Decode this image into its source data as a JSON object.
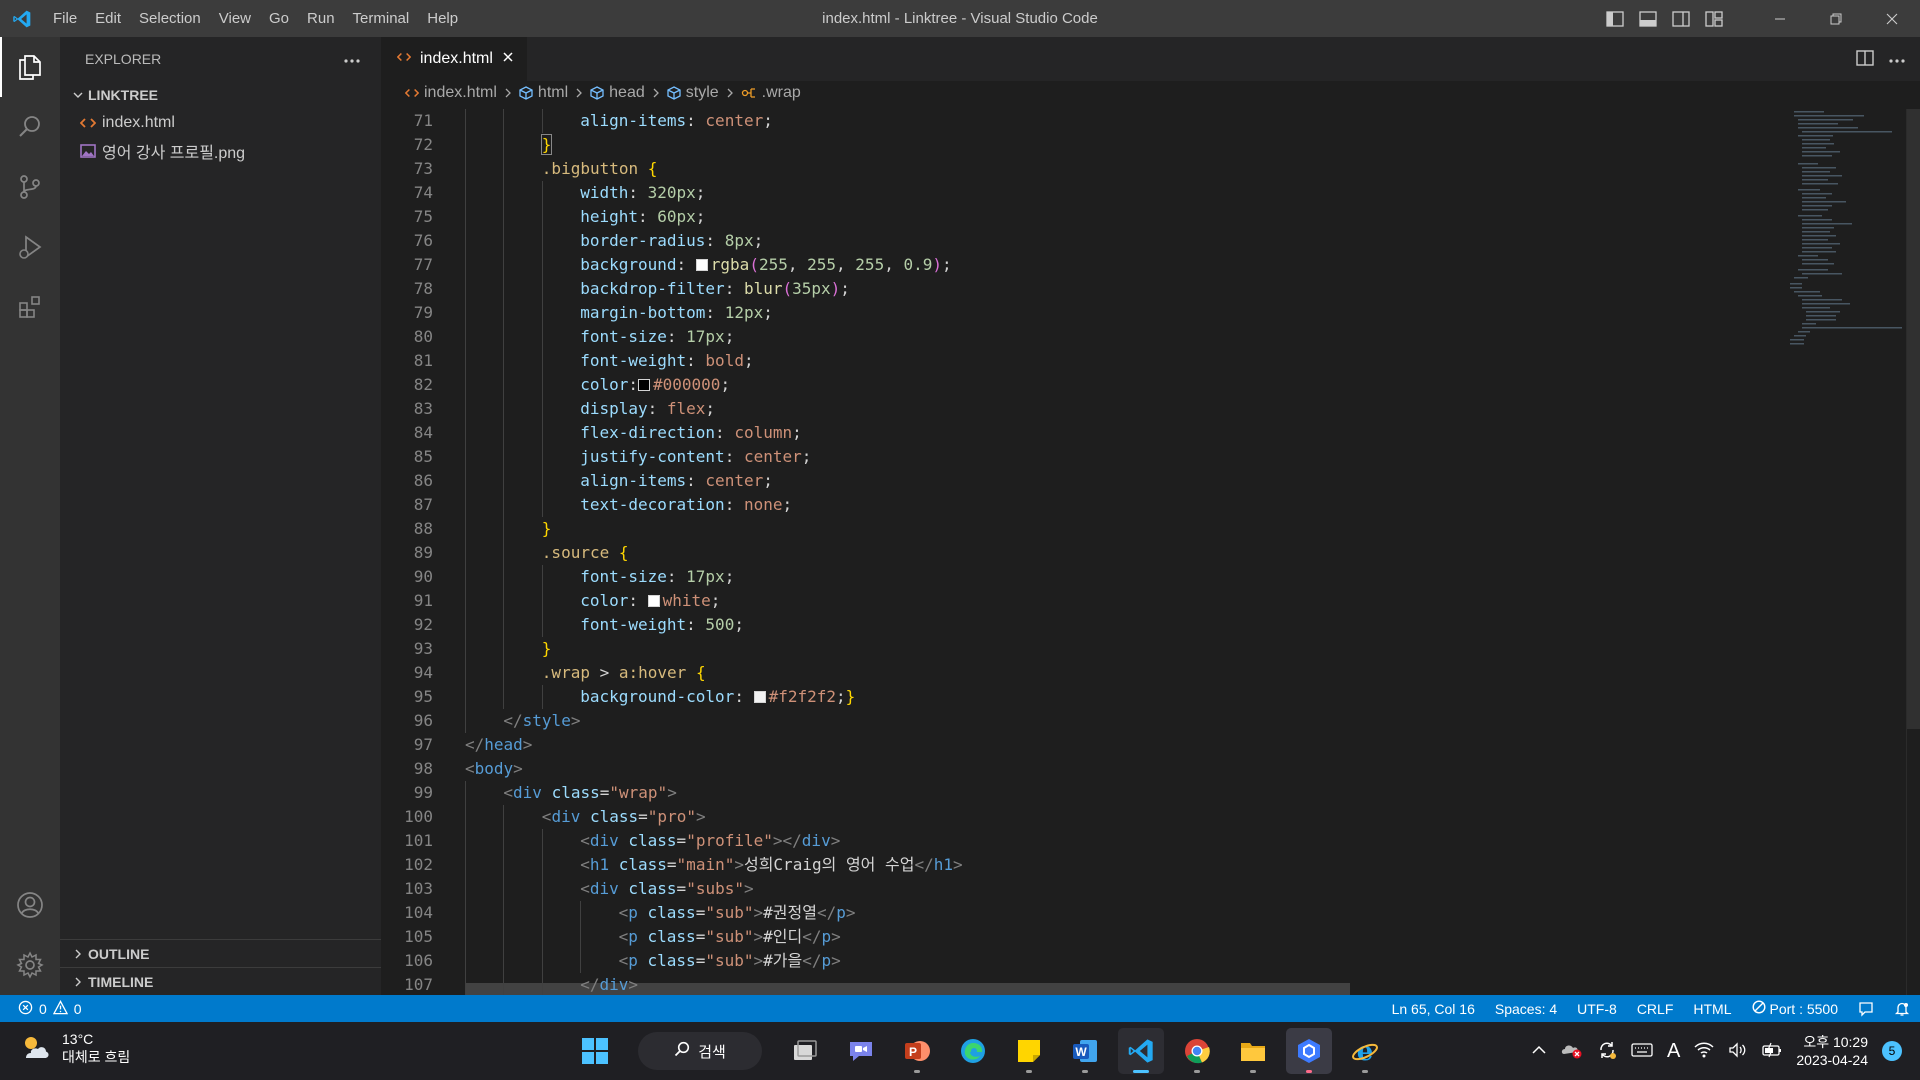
{
  "window": {
    "title": "index.html - Linktree - Visual Studio Code",
    "menu": [
      "File",
      "Edit",
      "Selection",
      "View",
      "Go",
      "Run",
      "Terminal",
      "Help"
    ]
  },
  "sidebar": {
    "title": "EXPLORER",
    "folder": "LINKTREE",
    "files": [
      {
        "name": "index.html",
        "icon": "html-file-icon"
      },
      {
        "name": "영어 강사 프로필.png",
        "icon": "image-file-icon"
      }
    ],
    "outline_label": "OUTLINE",
    "timeline_label": "TIMELINE"
  },
  "editor": {
    "tab_label": "index.html",
    "breadcrumb": [
      "index.html",
      "html",
      "head",
      "style",
      ".wrap"
    ],
    "lines": [
      {
        "n": "71",
        "indent": 3,
        "tokens": [
          [
            "prop",
            "align-items"
          ],
          [
            "def",
            ": "
          ],
          [
            "val",
            "center"
          ],
          [
            "def",
            ";"
          ]
        ]
      },
      {
        "n": "72",
        "indent": 2,
        "tokens": [
          [
            "br",
            "}"
          ]
        ]
      },
      {
        "n": "73",
        "indent": 2,
        "tokens": [
          [
            "sel",
            ".bigbutton"
          ],
          [
            "def",
            " "
          ],
          [
            "br",
            "{"
          ]
        ]
      },
      {
        "n": "74",
        "indent": 3,
        "tokens": [
          [
            "prop",
            "width"
          ],
          [
            "def",
            ": "
          ],
          [
            "num",
            "320px"
          ],
          [
            "def",
            ";"
          ]
        ]
      },
      {
        "n": "75",
        "indent": 3,
        "tokens": [
          [
            "prop",
            "height"
          ],
          [
            "def",
            ": "
          ],
          [
            "num",
            "60px"
          ],
          [
            "def",
            ";"
          ]
        ]
      },
      {
        "n": "76",
        "indent": 3,
        "tokens": [
          [
            "prop",
            "border-radius"
          ],
          [
            "def",
            ": "
          ],
          [
            "num",
            "8px"
          ],
          [
            "def",
            ";"
          ]
        ]
      },
      {
        "n": "77",
        "indent": 3,
        "tokens": [
          [
            "prop",
            "background"
          ],
          [
            "def",
            ": "
          ],
          [
            "swatch",
            "#ffffff"
          ],
          [
            "fn",
            "rgba"
          ],
          [
            "br2",
            "("
          ],
          [
            "num",
            "255"
          ],
          [
            "def",
            ", "
          ],
          [
            "num",
            "255"
          ],
          [
            "def",
            ", "
          ],
          [
            "num",
            "255"
          ],
          [
            "def",
            ", "
          ],
          [
            "num",
            "0.9"
          ],
          [
            "br2",
            ")"
          ],
          [
            "def",
            ";"
          ]
        ]
      },
      {
        "n": "78",
        "indent": 3,
        "tokens": [
          [
            "prop",
            "backdrop-filter"
          ],
          [
            "def",
            ": "
          ],
          [
            "fn",
            "blur"
          ],
          [
            "br2",
            "("
          ],
          [
            "num",
            "35px"
          ],
          [
            "br2",
            ")"
          ],
          [
            "def",
            ";"
          ]
        ]
      },
      {
        "n": "79",
        "indent": 3,
        "tokens": [
          [
            "prop",
            "margin-bottom"
          ],
          [
            "def",
            ": "
          ],
          [
            "num",
            "12px"
          ],
          [
            "def",
            ";"
          ]
        ]
      },
      {
        "n": "80",
        "indent": 3,
        "tokens": [
          [
            "prop",
            "font-size"
          ],
          [
            "def",
            ": "
          ],
          [
            "num",
            "17px"
          ],
          [
            "def",
            ";"
          ]
        ]
      },
      {
        "n": "81",
        "indent": 3,
        "tokens": [
          [
            "prop",
            "font-weight"
          ],
          [
            "def",
            ": "
          ],
          [
            "val",
            "bold"
          ],
          [
            "def",
            ";"
          ]
        ]
      },
      {
        "n": "82",
        "indent": 3,
        "tokens": [
          [
            "prop",
            "color"
          ],
          [
            "def",
            ":"
          ],
          [
            "swatch",
            "#000000"
          ],
          [
            "val",
            "#000000"
          ],
          [
            "def",
            ";"
          ]
        ]
      },
      {
        "n": "83",
        "indent": 3,
        "tokens": [
          [
            "prop",
            "display"
          ],
          [
            "def",
            ": "
          ],
          [
            "val",
            "flex"
          ],
          [
            "def",
            ";"
          ]
        ]
      },
      {
        "n": "84",
        "indent": 3,
        "tokens": [
          [
            "prop",
            "flex-direction"
          ],
          [
            "def",
            ": "
          ],
          [
            "val",
            "column"
          ],
          [
            "def",
            ";"
          ]
        ]
      },
      {
        "n": "85",
        "indent": 3,
        "tokens": [
          [
            "prop",
            "justify-content"
          ],
          [
            "def",
            ": "
          ],
          [
            "val",
            "center"
          ],
          [
            "def",
            ";"
          ]
        ]
      },
      {
        "n": "86",
        "indent": 3,
        "tokens": [
          [
            "prop",
            "align-items"
          ],
          [
            "def",
            ": "
          ],
          [
            "val",
            "center"
          ],
          [
            "def",
            ";"
          ]
        ]
      },
      {
        "n": "87",
        "indent": 3,
        "tokens": [
          [
            "prop",
            "text-decoration"
          ],
          [
            "def",
            ": "
          ],
          [
            "val",
            "none"
          ],
          [
            "def",
            ";"
          ]
        ]
      },
      {
        "n": "88",
        "indent": 2,
        "tokens": [
          [
            "br",
            "}"
          ]
        ]
      },
      {
        "n": "89",
        "indent": 2,
        "tokens": [
          [
            "sel",
            ".source"
          ],
          [
            "def",
            " "
          ],
          [
            "br",
            "{"
          ]
        ]
      },
      {
        "n": "90",
        "indent": 3,
        "tokens": [
          [
            "prop",
            "font-size"
          ],
          [
            "def",
            ": "
          ],
          [
            "num",
            "17px"
          ],
          [
            "def",
            ";"
          ]
        ]
      },
      {
        "n": "91",
        "indent": 3,
        "tokens": [
          [
            "prop",
            "color"
          ],
          [
            "def",
            ": "
          ],
          [
            "swatch",
            "#ffffff"
          ],
          [
            "val",
            "white"
          ],
          [
            "def",
            ";"
          ]
        ]
      },
      {
        "n": "92",
        "indent": 3,
        "tokens": [
          [
            "prop",
            "font-weight"
          ],
          [
            "def",
            ": "
          ],
          [
            "num",
            "500"
          ],
          [
            "def",
            ";"
          ]
        ]
      },
      {
        "n": "93",
        "indent": 2,
        "tokens": [
          [
            "br",
            "}"
          ]
        ]
      },
      {
        "n": "94",
        "indent": 2,
        "tokens": [
          [
            "sel",
            ".wrap"
          ],
          [
            "def",
            " > "
          ],
          [
            "sel",
            "a:hover"
          ],
          [
            "def",
            " "
          ],
          [
            "br",
            "{"
          ]
        ]
      },
      {
        "n": "95",
        "indent": 3,
        "tokens": [
          [
            "prop",
            "background-color"
          ],
          [
            "def",
            ": "
          ],
          [
            "swatch",
            "#f2f2f2"
          ],
          [
            "val",
            "#f2f2f2"
          ],
          [
            "def",
            ";"
          ],
          [
            "br",
            "}"
          ]
        ]
      },
      {
        "n": "96",
        "indent": 1,
        "tokens": [
          [
            "pun",
            "</"
          ],
          [
            "tag",
            "style"
          ],
          [
            "pun",
            ">"
          ]
        ]
      },
      {
        "n": "97",
        "indent": 0,
        "tokens": [
          [
            "pun",
            "</"
          ],
          [
            "tag",
            "head"
          ],
          [
            "pun",
            ">"
          ]
        ]
      },
      {
        "n": "98",
        "indent": 0,
        "tokens": [
          [
            "pun",
            "<"
          ],
          [
            "tag",
            "body"
          ],
          [
            "pun",
            ">"
          ]
        ]
      },
      {
        "n": "99",
        "indent": 1,
        "tokens": [
          [
            "pun",
            "<"
          ],
          [
            "tag",
            "div"
          ],
          [
            "def",
            " "
          ],
          [
            "attr",
            "class"
          ],
          [
            "def",
            "="
          ],
          [
            "str",
            "\"wrap\""
          ],
          [
            "pun",
            ">"
          ]
        ]
      },
      {
        "n": "100",
        "indent": 2,
        "tokens": [
          [
            "pun",
            "<"
          ],
          [
            "tag",
            "div"
          ],
          [
            "def",
            " "
          ],
          [
            "attr",
            "class"
          ],
          [
            "def",
            "="
          ],
          [
            "str",
            "\"pro\""
          ],
          [
            "pun",
            ">"
          ]
        ]
      },
      {
        "n": "101",
        "indent": 3,
        "tokens": [
          [
            "pun",
            "<"
          ],
          [
            "tag",
            "div"
          ],
          [
            "def",
            " "
          ],
          [
            "attr",
            "class"
          ],
          [
            "def",
            "="
          ],
          [
            "str",
            "\"profile\""
          ],
          [
            "pun",
            "></"
          ],
          [
            "tag",
            "div"
          ],
          [
            "pun",
            ">"
          ]
        ]
      },
      {
        "n": "102",
        "indent": 3,
        "tokens": [
          [
            "pun",
            "<"
          ],
          [
            "tag",
            "h1"
          ],
          [
            "def",
            " "
          ],
          [
            "attr",
            "class"
          ],
          [
            "def",
            "="
          ],
          [
            "str",
            "\"main\""
          ],
          [
            "pun",
            ">"
          ],
          [
            "def",
            "성희Craig의 영어 수업"
          ],
          [
            "pun",
            "</"
          ],
          [
            "tag",
            "h1"
          ],
          [
            "pun",
            ">"
          ]
        ]
      },
      {
        "n": "103",
        "indent": 3,
        "tokens": [
          [
            "pun",
            "<"
          ],
          [
            "tag",
            "div"
          ],
          [
            "def",
            " "
          ],
          [
            "attr",
            "class"
          ],
          [
            "def",
            "="
          ],
          [
            "str",
            "\"subs\""
          ],
          [
            "pun",
            ">"
          ]
        ]
      },
      {
        "n": "104",
        "indent": 4,
        "tokens": [
          [
            "pun",
            "<"
          ],
          [
            "tag",
            "p"
          ],
          [
            "def",
            " "
          ],
          [
            "attr",
            "class"
          ],
          [
            "def",
            "="
          ],
          [
            "str",
            "\"sub\""
          ],
          [
            "pun",
            ">"
          ],
          [
            "def",
            "#권정열"
          ],
          [
            "pun",
            "</"
          ],
          [
            "tag",
            "p"
          ],
          [
            "pun",
            ">"
          ]
        ]
      },
      {
        "n": "105",
        "indent": 4,
        "tokens": [
          [
            "pun",
            "<"
          ],
          [
            "tag",
            "p"
          ],
          [
            "def",
            " "
          ],
          [
            "attr",
            "class"
          ],
          [
            "def",
            "="
          ],
          [
            "str",
            "\"sub\""
          ],
          [
            "pun",
            ">"
          ],
          [
            "def",
            "#인디"
          ],
          [
            "pun",
            "</"
          ],
          [
            "tag",
            "p"
          ],
          [
            "pun",
            ">"
          ]
        ]
      },
      {
        "n": "106",
        "indent": 4,
        "tokens": [
          [
            "pun",
            "<"
          ],
          [
            "tag",
            "p"
          ],
          [
            "def",
            " "
          ],
          [
            "attr",
            "class"
          ],
          [
            "def",
            "="
          ],
          [
            "str",
            "\"sub\""
          ],
          [
            "pun",
            ">"
          ],
          [
            "def",
            "#가을"
          ],
          [
            "pun",
            "</"
          ],
          [
            "tag",
            "p"
          ],
          [
            "pun",
            ">"
          ]
        ]
      },
      {
        "n": "107",
        "indent": 3,
        "tokens": [
          [
            "pun",
            "</"
          ],
          [
            "tag",
            "div"
          ],
          [
            "pun",
            ">"
          ]
        ]
      }
    ]
  },
  "statusbar": {
    "errors": "0",
    "warnings": "0",
    "position": "Ln 65, Col 16",
    "spaces": "Spaces: 4",
    "encoding": "UTF-8",
    "eol": "CRLF",
    "language": "HTML",
    "port": "Port : 5500"
  },
  "taskbar": {
    "temperature": "13°C",
    "weather": "대체로 흐림",
    "search_label": "검색",
    "apps": [
      "file-explorer-multitask-icon",
      "teams-chat-icon",
      "powerpoint-icon",
      "edge-icon",
      "sticky-notes-icon",
      "word-icon",
      "vscode-icon",
      "chrome-icon",
      "folder-icon",
      "app-shield-icon",
      "internet-explorer-icon"
    ],
    "time": "오후 10:29",
    "date": "2023-04-24",
    "notification_count": "5",
    "ime_label": "A"
  },
  "colors": {
    "accent": "#007acc",
    "titlebar": "#3c3c3c",
    "sidebar": "#252526",
    "editor": "#1e1e1e"
  }
}
